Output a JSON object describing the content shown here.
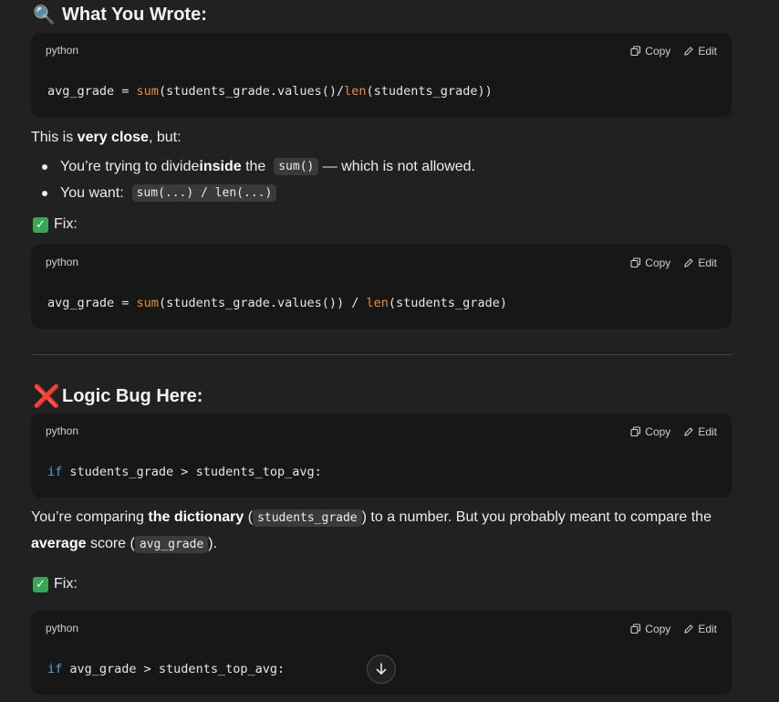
{
  "section1": {
    "emoji": "🔍",
    "title": "What You Wrote:"
  },
  "code_actions": {
    "copy_label": "Copy",
    "edit_label": "Edit"
  },
  "code1": {
    "lang": "python",
    "line": {
      "a": "avg_grade = ",
      "b": "sum",
      "c": "(students_grade.values()/",
      "d": "len",
      "e": "(students_grade))"
    }
  },
  "explain1": {
    "prefix": "This is ",
    "bold": "very close",
    "suffix": ", but:"
  },
  "bullets": [
    {
      "t1": "You’re trying to divide ",
      "b1": "inside",
      "t2": " the ",
      "code": "sum()",
      "t3": " — which is not allowed."
    },
    {
      "t1": "You want: ",
      "code": "sum(...) / len(...)"
    }
  ],
  "fix_label": "Fix:",
  "code2": {
    "lang": "python",
    "line": {
      "a": "avg_grade = ",
      "b": "sum",
      "c": "(students_grade.values()) / ",
      "d": "len",
      "e": "(students_grade)"
    }
  },
  "section2": {
    "emoji": "❌",
    "title": "Logic Bug Here:"
  },
  "code3": {
    "lang": "python",
    "line": {
      "kw": "if",
      "rest": " students_grade > students_top_avg:"
    }
  },
  "explain2": {
    "line1": {
      "t1": "You’re comparing ",
      "b1": "the dictionary",
      "t2": " (",
      "code": "students_grade",
      "t3": ") to a number. But you probably meant to compare the"
    },
    "line2": {
      "b1": "average",
      "t1": " score (",
      "code": "avg_grade",
      "t2": ")."
    }
  },
  "code4": {
    "lang": "python",
    "line": {
      "kw": "if",
      "rest": " avg_grade > students_top_avg:"
    }
  }
}
